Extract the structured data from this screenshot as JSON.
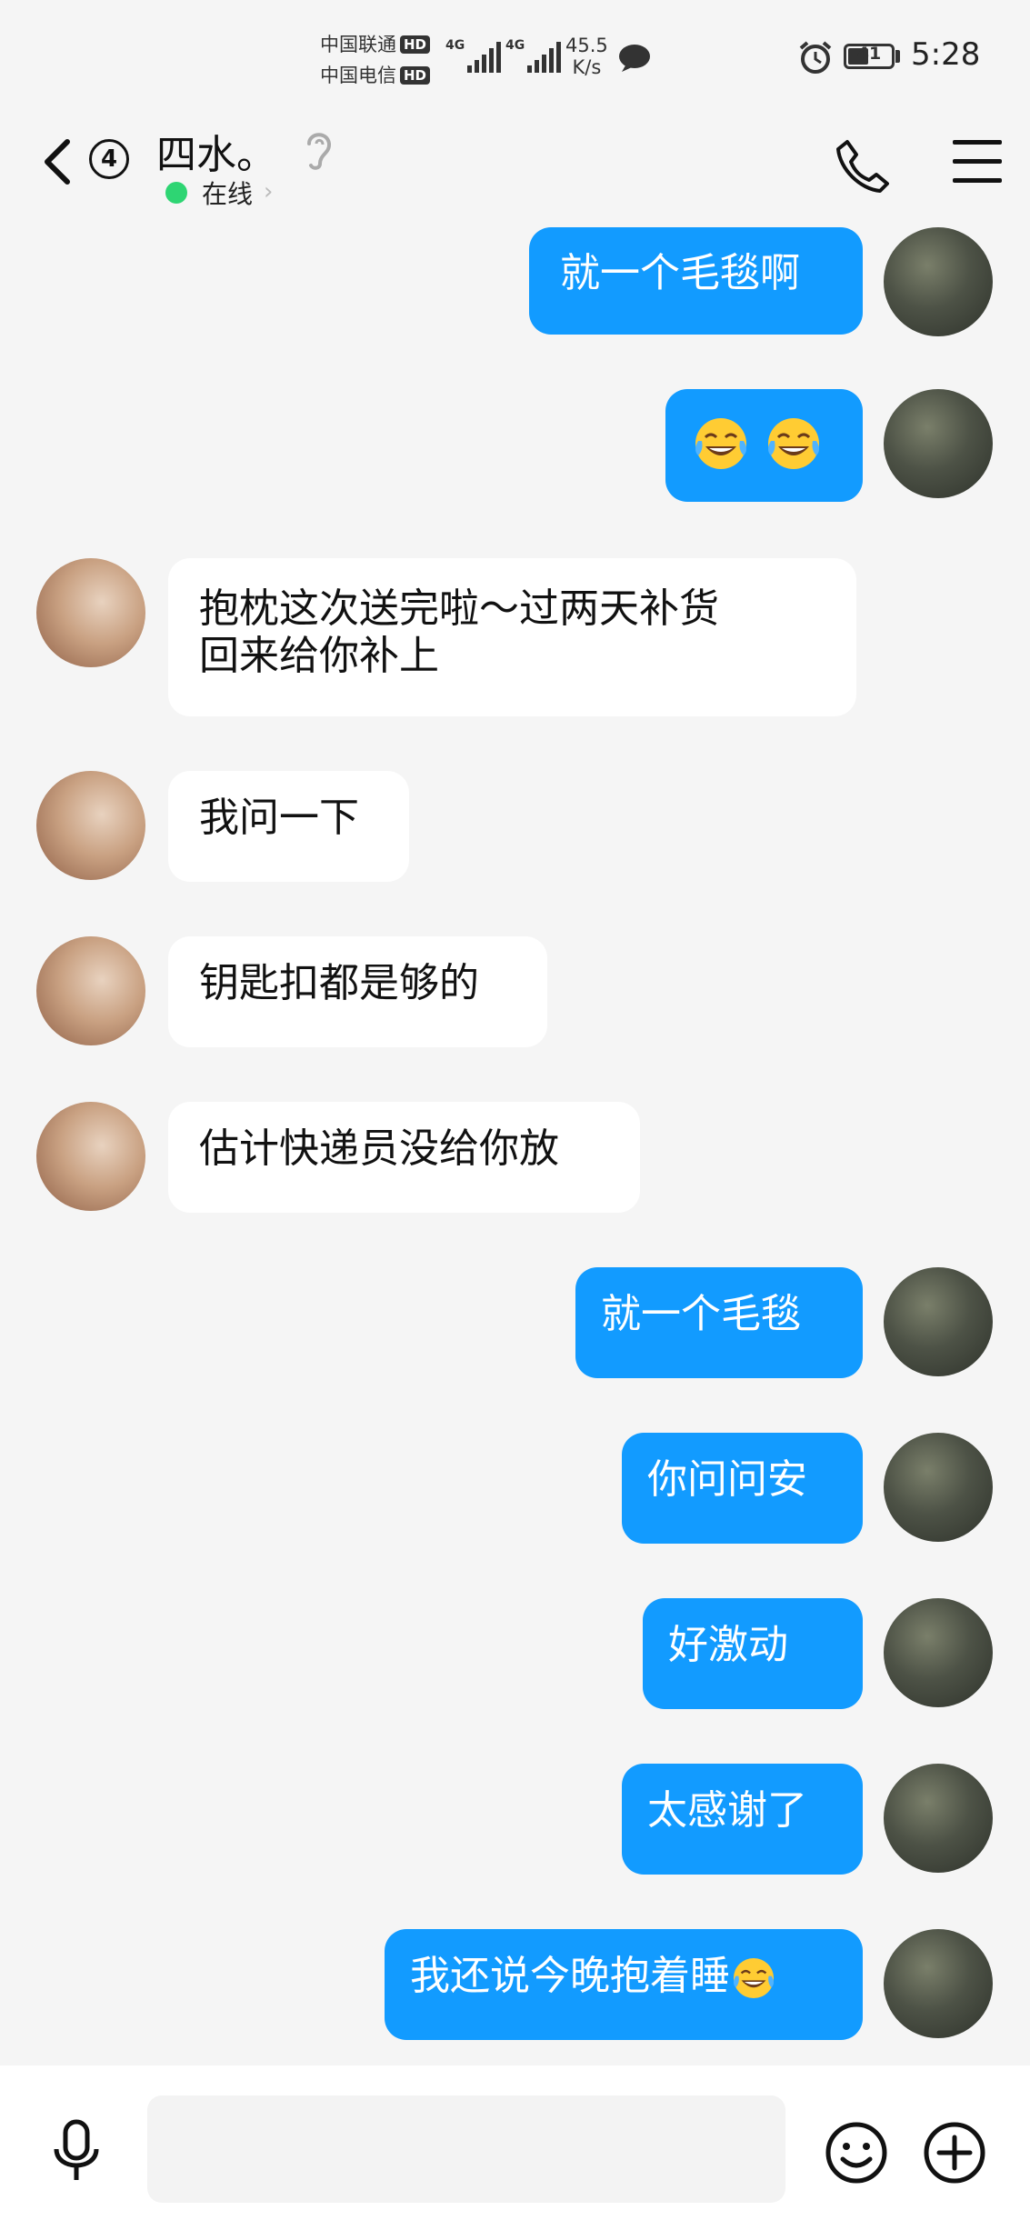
{
  "status_bar": {
    "carrier1": "中国联通",
    "carrier2": "中国电信",
    "hd_badge": "HD",
    "net1": "4G",
    "net2": "4G",
    "speed_value": "45.5",
    "speed_unit": "K/s",
    "battery": "41",
    "time": "5:28"
  },
  "header": {
    "unread_count": "4",
    "contact_name": "四水。",
    "online_status": "在线"
  },
  "messages": [
    {
      "from": "me",
      "text": "就一个毛毯啊"
    },
    {
      "from": "me",
      "text": "",
      "emoji": [
        "face-with-tears-of-joy",
        "face-with-tears-of-joy"
      ]
    },
    {
      "from": "other",
      "line1": "抱枕这次送完啦～过两天补货",
      "line2": "回来给你补上"
    },
    {
      "from": "other",
      "text": "我问一下"
    },
    {
      "from": "other",
      "text": "钥匙扣都是够的"
    },
    {
      "from": "other",
      "text": "估计快递员没给你放"
    },
    {
      "from": "me",
      "text": "就一个毛毯"
    },
    {
      "from": "me",
      "text": "你问问安"
    },
    {
      "from": "me",
      "text": "好激动"
    },
    {
      "from": "me",
      "text": "太感谢了"
    },
    {
      "from": "me",
      "text": "我还说今晚抱着睡",
      "emoji": [
        "face-with-tears-of-joy"
      ]
    }
  ],
  "input": {
    "placeholder": ""
  },
  "colors": {
    "my_bubble": "#129bff",
    "other_bubble": "#ffffff",
    "online": "#2ed573"
  }
}
